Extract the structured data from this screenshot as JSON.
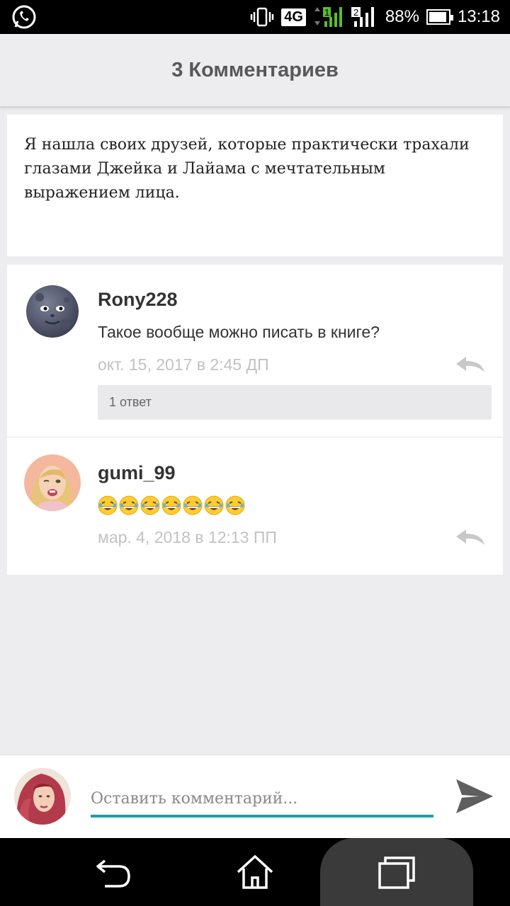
{
  "status_bar": {
    "network": "4G",
    "sim1": "1",
    "sim2": "2",
    "battery": "88%",
    "time": "13:18"
  },
  "header": {
    "title": "3 Комментариев"
  },
  "quote": {
    "text": "Я нашла своих друзей, которые практически трахали глазами Джейка и Лайама с мечтательным выражением лица."
  },
  "comments": [
    {
      "author": "Rony228",
      "text": "Такое вообще можно писать в книге?",
      "date": "окт. 15, 2017 в 2:45 ДП",
      "replies_label": "1 ответ",
      "avatar_icon": "new-moon-face-icon"
    },
    {
      "author": "gumi_99",
      "emoji_icon": "grinning-squinting-face-icon",
      "emoji_count": 7,
      "date": "мар. 4, 2018 в 12:13 ПП",
      "avatar_icon": "user-photo-avatar"
    }
  ],
  "composer": {
    "placeholder": "Оставить комментарий...",
    "accent_color": "#1e9fa9"
  },
  "colors": {
    "background": "#ededef",
    "meta_text": "#c2c2c2"
  }
}
